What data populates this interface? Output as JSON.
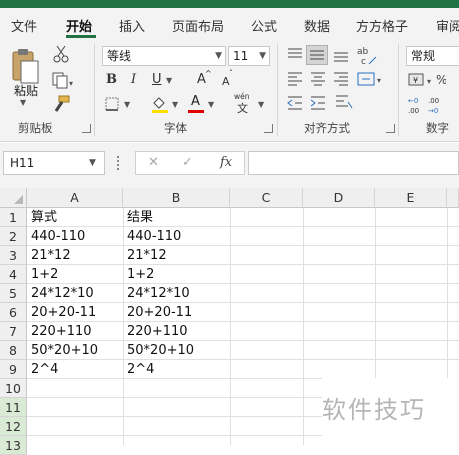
{
  "menu": {
    "tabs": [
      "文件",
      "开始",
      "插入",
      "页面布局",
      "公式",
      "数据",
      "方方格子",
      "审阅"
    ],
    "active_tab": "开始"
  },
  "ribbon": {
    "clipboard": {
      "paste_label": "粘贴",
      "group_label": "剪贴板"
    },
    "font": {
      "font_name": "等线",
      "font_size": "11",
      "bold": "B",
      "italic": "I",
      "underline": "U",
      "grow": "A",
      "shrink": "A",
      "font_color": "A",
      "phonetic": "wén",
      "group_label": "字体"
    },
    "alignment": {
      "group_label": "对齐方式"
    },
    "number": {
      "format": "常规",
      "group_label": "数字"
    }
  },
  "formula_bar": {
    "name_box": "H11",
    "cancel": "✕",
    "enter": "✓",
    "fx": "fx",
    "value": ""
  },
  "sheet": {
    "columns": [
      "A",
      "B",
      "C",
      "D",
      "E"
    ],
    "rows": [
      "1",
      "2",
      "3",
      "4",
      "5",
      "6",
      "7",
      "8",
      "9",
      "10",
      "11",
      "12",
      "13"
    ],
    "cells": [
      [
        "算式",
        "结果"
      ],
      [
        "440-110",
        "440-110"
      ],
      [
        "21*12",
        "21*12"
      ],
      [
        "1+2",
        "1+2"
      ],
      [
        "24*12*10",
        "24*12*10"
      ],
      [
        "20+20-11",
        "20+20-11"
      ],
      [
        "220+110",
        "220+110"
      ],
      [
        "50*20+10",
        "50*20+10"
      ],
      [
        "2^4",
        "2^4"
      ]
    ]
  },
  "watermark": "软件技巧",
  "colors": {
    "accent": "#217346",
    "ribbon_bg": "#f3f3f3",
    "selected_row_header": "#d9ead5"
  }
}
